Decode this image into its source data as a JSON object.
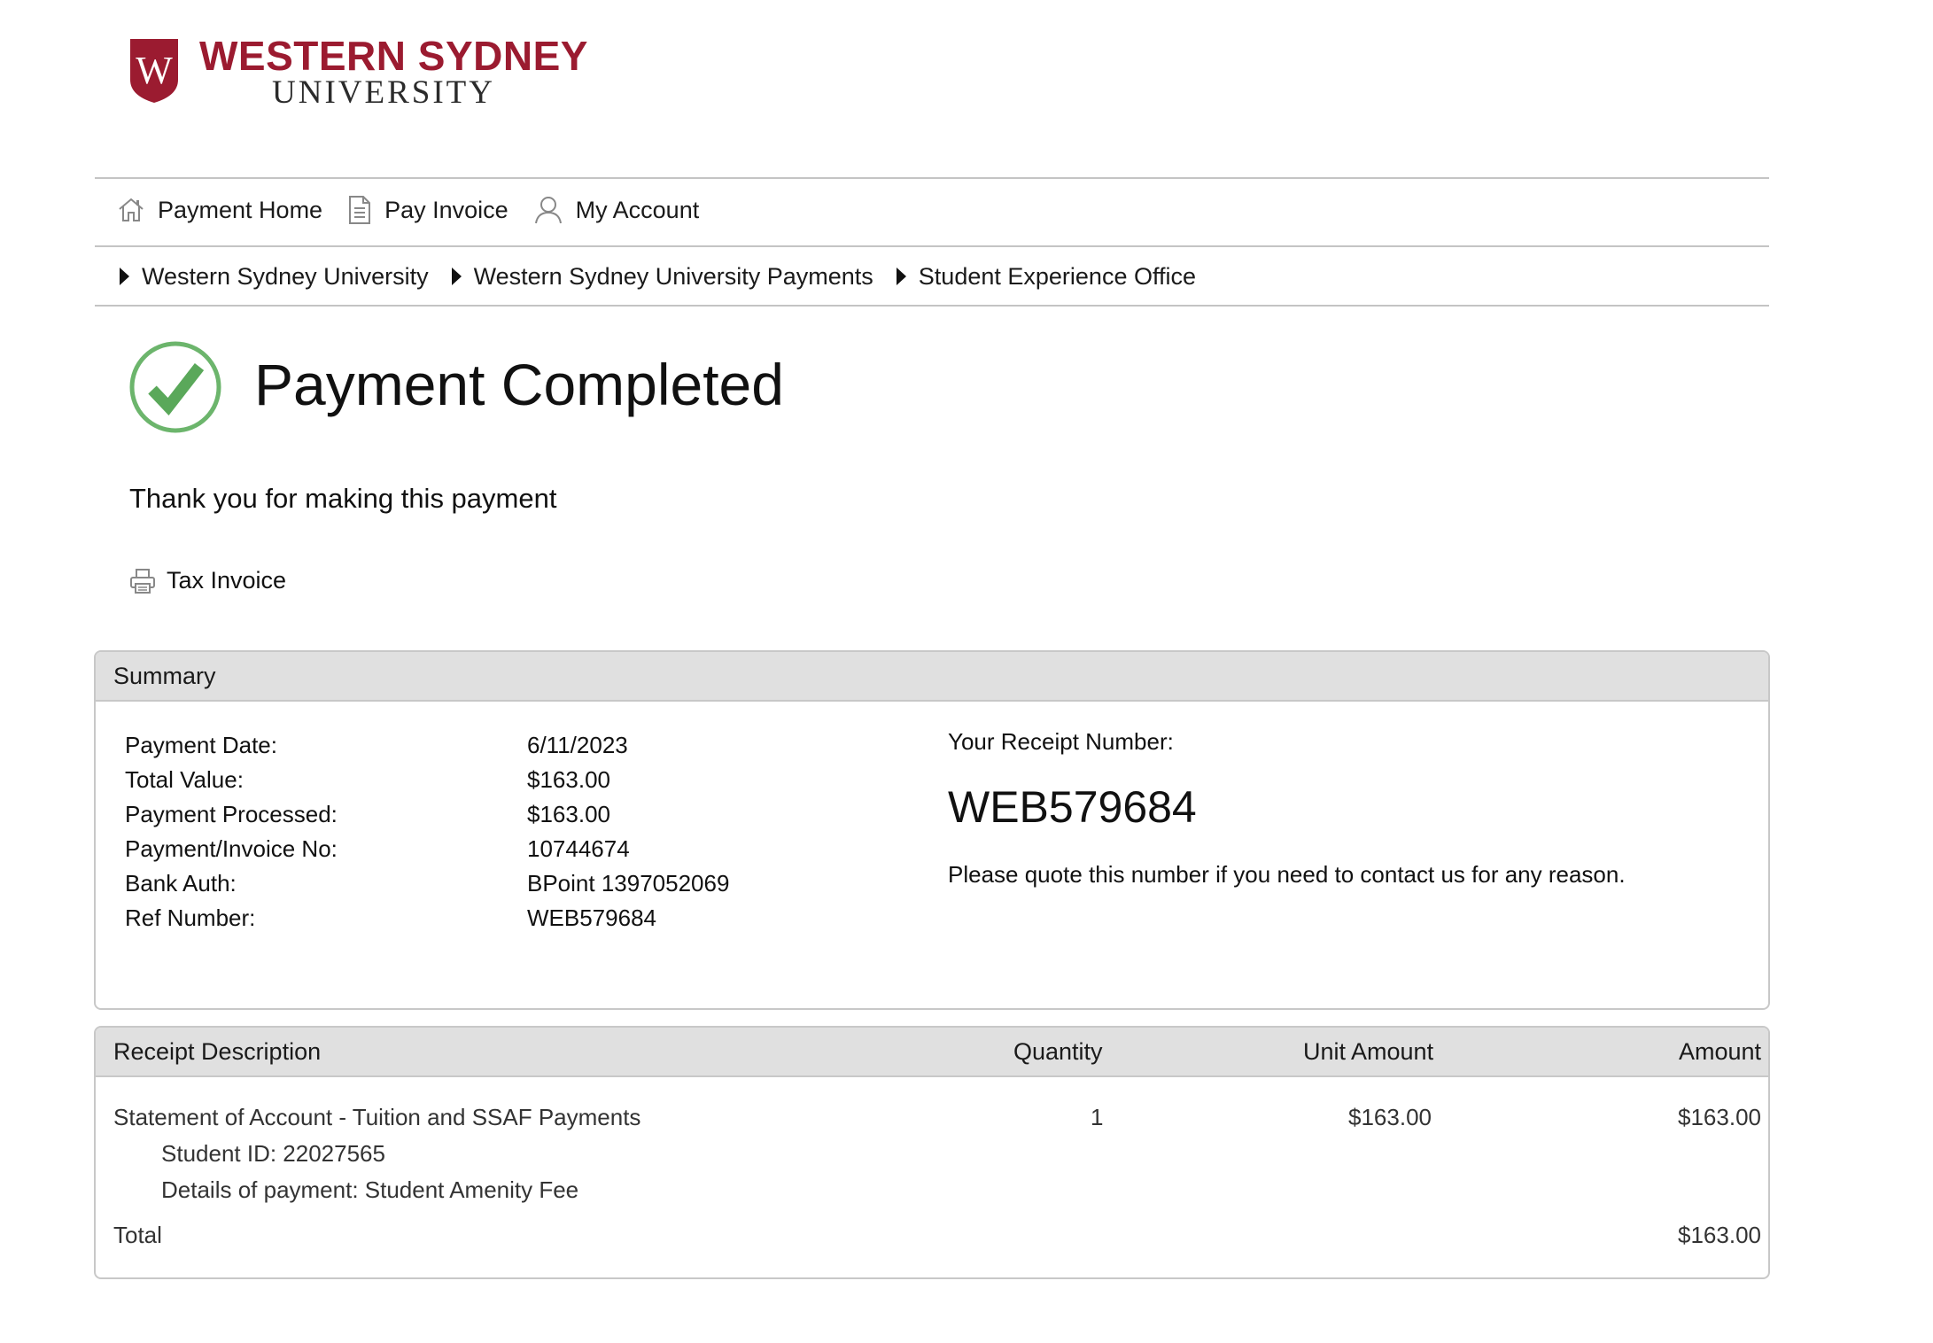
{
  "logo": {
    "line1": "WESTERN SYDNEY",
    "line2": "UNIVERSITY",
    "shield_letter": "W",
    "brand_color": "#9b1b30"
  },
  "topnav": [
    {
      "label": "Payment Home",
      "icon": "home-icon"
    },
    {
      "label": "Pay Invoice",
      "icon": "document-icon"
    },
    {
      "label": "My Account",
      "icon": "user-icon"
    }
  ],
  "breadcrumb": [
    "Western Sydney University",
    "Western Sydney University Payments",
    "Student Experience Office"
  ],
  "status": {
    "title": "Payment Completed",
    "icon": "checkmark-circle-icon",
    "accent_color": "#6cb56c",
    "thanks": "Thank you for making this payment",
    "tax_invoice_label": "Tax Invoice"
  },
  "summary": {
    "heading": "Summary",
    "rows": [
      {
        "label": "Payment Date:",
        "value": "6/11/2023"
      },
      {
        "label": "Total Value:",
        "value": "$163.00"
      },
      {
        "label": "Payment Processed:",
        "value": "$163.00"
      },
      {
        "label": "Payment/Invoice No:",
        "value": "10744674"
      },
      {
        "label": "Bank Auth:",
        "value": "BPoint 1397052069"
      },
      {
        "label": "Ref Number:",
        "value": "WEB579684"
      }
    ],
    "receipt_label": "Your Receipt Number:",
    "receipt_number": "WEB579684",
    "receipt_note": "Please quote this number if you need to contact us for any reason."
  },
  "receipt": {
    "columns": [
      "Receipt Description",
      "Quantity",
      "Unit Amount",
      "Amount"
    ],
    "item": {
      "description": "Statement of Account - Tuition and SSAF Payments",
      "student_id": "Student ID: 22027565",
      "details": "Details of payment: Student Amenity Fee",
      "quantity": "1",
      "unit_amount": "$163.00",
      "amount": "$163.00"
    },
    "total_label": "Total",
    "total_amount": "$163.00"
  }
}
